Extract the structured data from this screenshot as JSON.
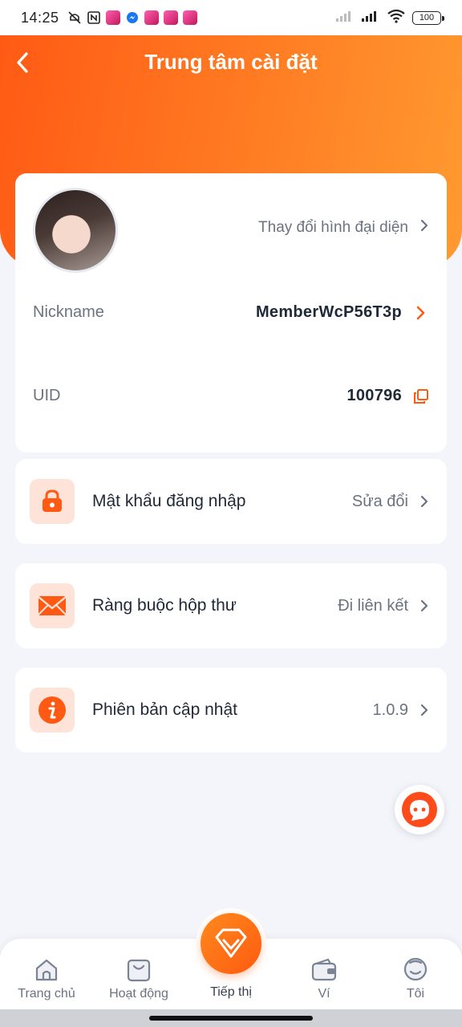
{
  "status_bar": {
    "time": "14:25",
    "battery": "100"
  },
  "header": {
    "title": "Trung tâm cài đặt"
  },
  "profile": {
    "change_avatar_label": "Thay đổi hình đại diện",
    "nickname_label": "Nickname",
    "nickname_value": "MemberWcP56T3p",
    "uid_label": "UID",
    "uid_value": "100796"
  },
  "menu": [
    {
      "label": "Mật khẩu đăng nhập",
      "value": "Sửa đổi",
      "icon": "lock-icon"
    },
    {
      "label": "Ràng buộc hộp thư",
      "value": "Đi liên kết",
      "icon": "mail-icon"
    },
    {
      "label": "Phiên bản cập nhật",
      "value": "1.0.9",
      "icon": "info-icon"
    }
  ],
  "tabbar": {
    "home": "Trang chủ",
    "activity": "Hoạt động",
    "promo": "Tiếp thị",
    "wallet": "Ví",
    "me": "Tôi"
  },
  "colors": {
    "accent": "#ff6a1a",
    "accent_light": "#fde3d8",
    "background": "#f4f5fb"
  }
}
